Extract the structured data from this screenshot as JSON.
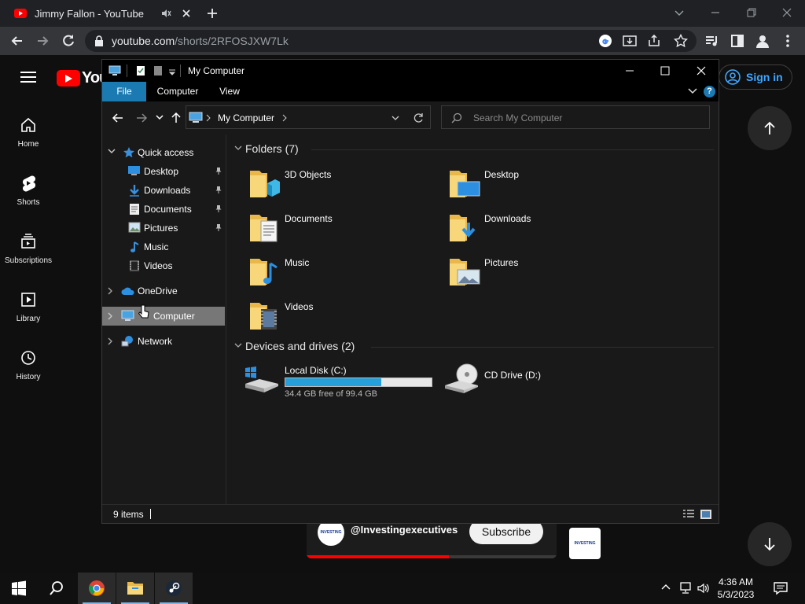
{
  "browser": {
    "tab_title": "Jimmy Fallon - YouTube",
    "url_host": "youtube.com",
    "url_path": "/shorts/2RFOSJXW7Lk"
  },
  "youtube": {
    "logo_text": "You",
    "nav": [
      {
        "label": "Home"
      },
      {
        "label": "Shorts"
      },
      {
        "label": "Subscriptions"
      },
      {
        "label": "Library"
      },
      {
        "label": "History"
      }
    ],
    "sign_in": "Sign in",
    "channel_handle": "@Investingexecutives",
    "subscribe": "Subscribe",
    "avatar_text": "INVESTING EXECUTIVES",
    "progress": 0.57
  },
  "explorer": {
    "title": "My Computer",
    "ribbon_tabs": [
      {
        "label": "File"
      },
      {
        "label": "Computer"
      },
      {
        "label": "View"
      }
    ],
    "help": "?",
    "address": "My Computer",
    "search_placeholder": "Search My Computer",
    "nav": {
      "quick_access": "Quick access",
      "quick_items": [
        {
          "label": "Desktop"
        },
        {
          "label": "Downloads"
        },
        {
          "label": "Documents"
        },
        {
          "label": "Pictures"
        },
        {
          "label": "Music"
        },
        {
          "label": "Videos"
        }
      ],
      "onedrive": "OneDrive",
      "computer": "Computer",
      "network": "Network"
    },
    "folders_header": "Folders (7)",
    "folders": [
      {
        "name": "3D Objects"
      },
      {
        "name": "Desktop"
      },
      {
        "name": "Documents"
      },
      {
        "name": "Downloads"
      },
      {
        "name": "Music"
      },
      {
        "name": "Pictures"
      },
      {
        "name": "Videos"
      }
    ],
    "drives_header": "Devices and drives (2)",
    "drives": [
      {
        "name": "Local Disk (C:)",
        "free": "34.4 GB free of 99.4 GB",
        "used_fraction": 0.654
      },
      {
        "name": "CD Drive (D:)"
      }
    ],
    "status": "9 items"
  },
  "taskbar": {
    "time": "4:36 AM",
    "date": "5/3/2023"
  },
  "colors": {
    "accent": "#1c7ab3",
    "youtube_red": "#ff0000",
    "link_blue": "#3ea6ff",
    "disk_bar": "#26a0da"
  }
}
